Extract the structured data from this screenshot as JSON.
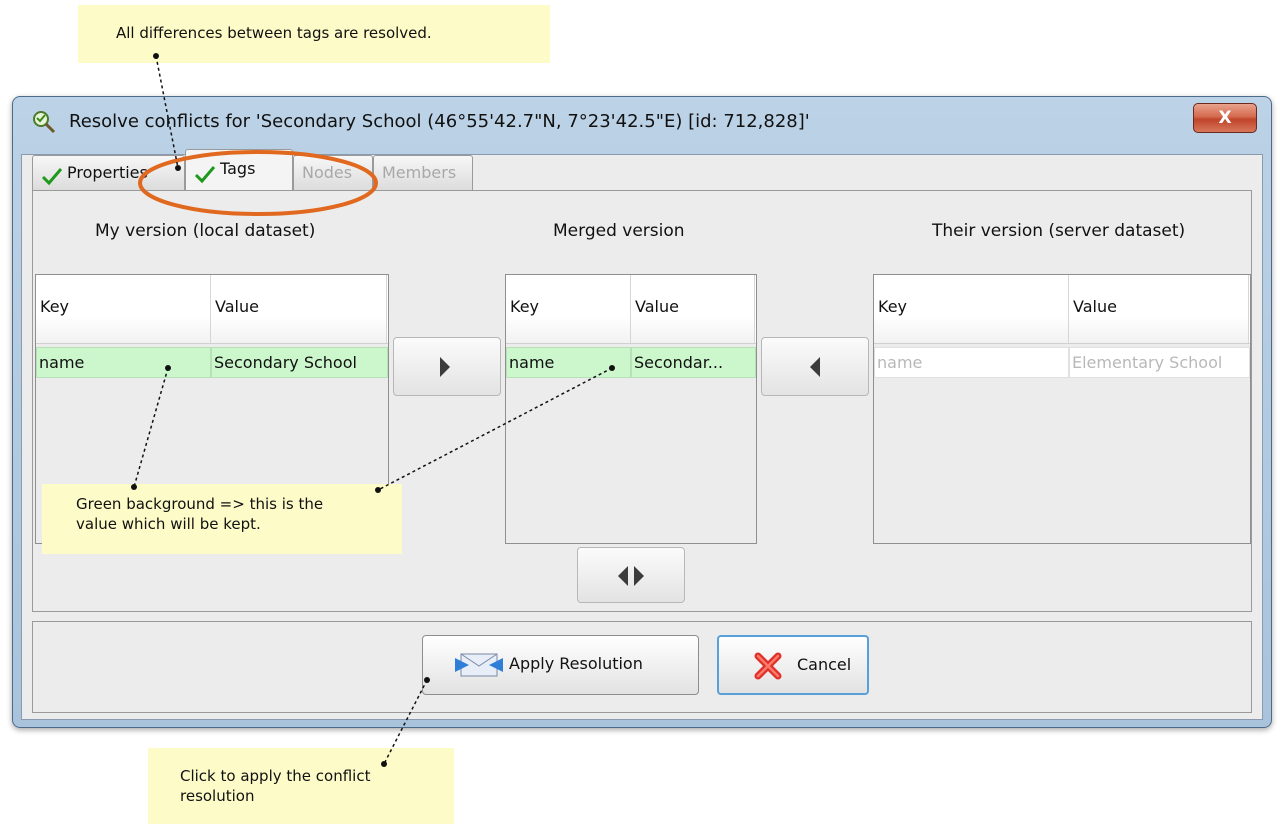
{
  "notes": {
    "top": "All differences between tags are resolved.",
    "green_line1": "Green background => this is the",
    "green_line2": "value which will be kept.",
    "apply_line1": "Click to apply the conflict",
    "apply_line2": "resolution"
  },
  "window": {
    "title": "Resolve conflicts for 'Secondary School (46°55'42.7\"N, 7°23'42.5\"E) [id: 712,828]'",
    "close_glyph": "X"
  },
  "tabs": [
    {
      "label": "Properties",
      "resolved": true,
      "enabled": true
    },
    {
      "label": "Tags",
      "resolved": true,
      "enabled": true,
      "selected": true
    },
    {
      "label": "Nodes",
      "enabled": false
    },
    {
      "label": "Members",
      "enabled": false
    }
  ],
  "panels": {
    "mine": {
      "title": "My version (local dataset)",
      "col_key": "Key",
      "col_value": "Value",
      "row": {
        "key": "name",
        "value": "Secondary School",
        "state": "kept"
      }
    },
    "merged": {
      "title": "Merged version",
      "col_key": "Key",
      "col_value": "Value",
      "row": {
        "key": "name",
        "value": "Secondar...",
        "state": "kept"
      }
    },
    "theirs": {
      "title": "Their version (server dataset)",
      "col_key": "Key",
      "col_value": "Value",
      "row": {
        "key": "name",
        "value": "Elementary School",
        "state": "discarded"
      }
    }
  },
  "buttons": {
    "apply": "Apply Resolution",
    "cancel": "Cancel"
  },
  "colors": {
    "kept_row": "#ccf7cc",
    "note_bg": "#fdfcc8",
    "highlight_ellipse": "#e0691f"
  }
}
